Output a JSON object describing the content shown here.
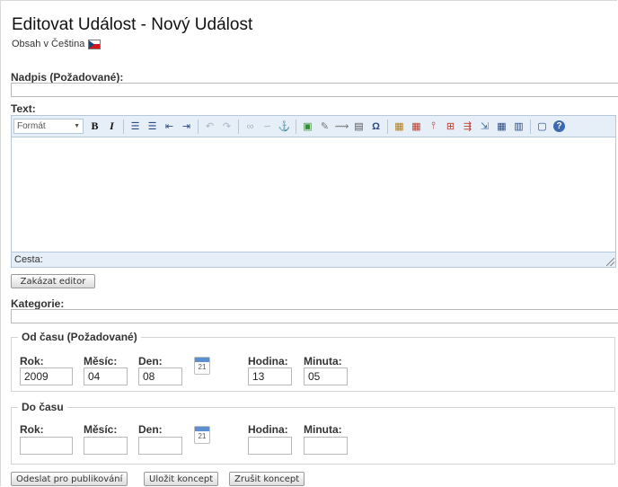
{
  "page": {
    "title": "Editovat Událost - Nový Událost",
    "language_label": "Obsah v Čeština",
    "language_flag_icon": "czech-flag-icon"
  },
  "form": {
    "title_label": "Nadpis (Požadované):",
    "title_value": "",
    "text_label": "Text:",
    "editor": {
      "format_select": "Formát",
      "toolbar_icons": [
        "bold-icon",
        "italic-icon",
        "bullet-list-icon",
        "numbered-list-icon",
        "outdent-icon",
        "indent-icon",
        "undo-icon",
        "redo-icon",
        "link-icon",
        "unlink-icon",
        "anchor-icon",
        "image-icon",
        "attachment-icon",
        "embed-icon",
        "template-icon",
        "special-char-icon",
        "table-props-icon",
        "row-props-icon",
        "insert-row-icon",
        "cell-props-icon",
        "merge-cells-icon",
        "split-cells-icon",
        "table-icon",
        "table-delete-icon",
        "fullscreen-icon",
        "help-icon"
      ],
      "path_label": "Cesta:",
      "content": ""
    },
    "disable_editor_label": "Zakázat editor",
    "category_label": "Kategorie:",
    "category_value": "",
    "from": {
      "legend": "Od času (Požadované)",
      "year_label": "Rok:",
      "year_value": "2009",
      "month_label": "Měsíc:",
      "month_value": "04",
      "day_label": "Den:",
      "day_value": "08",
      "calendar_day": "21",
      "hour_label": "Hodina:",
      "hour_value": "13",
      "minute_label": "Minuta:",
      "minute_value": "05"
    },
    "to": {
      "legend": "Do času",
      "year_label": "Rok:",
      "year_value": "",
      "month_label": "Měsíc:",
      "month_value": "",
      "day_label": "Den:",
      "day_value": "",
      "calendar_day": "21",
      "hour_label": "Hodina:",
      "hour_value": "",
      "minute_label": "Minuta:",
      "minute_value": ""
    },
    "buttons": {
      "publish": "Odeslat pro publikování",
      "save_draft": "Uložit koncept",
      "cancel_draft": "Zrušit koncept"
    }
  },
  "colors": {
    "toolbar_bg": "#e6eef7",
    "toolbar_border": "#b6c7d8",
    "calendar_accent": "#5b8fd0"
  }
}
